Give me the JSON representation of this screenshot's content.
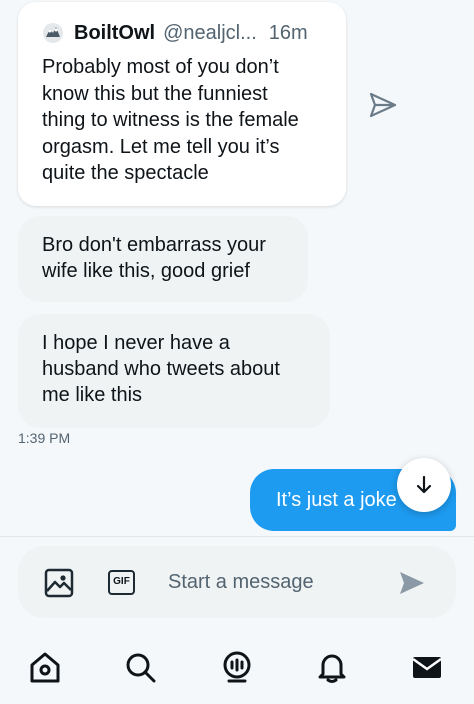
{
  "quoted_tweet": {
    "display_name": "BoiltOwl",
    "handle": "@nealjcl...",
    "time": "16m",
    "lines": [
      "Probably most of you don’t",
      "know this but the funniest",
      "thing to witness is the female",
      "orgasm. Let me tell you it’s",
      "quite the spectacle"
    ]
  },
  "messages": [
    {
      "direction": "received",
      "lines": [
        "Bro don't embarrass your",
        "wife like this, good grief"
      ]
    },
    {
      "direction": "received",
      "lines": [
        "I hope I never have a",
        "husband who tweets about",
        "me like this"
      ]
    },
    {
      "direction": "sent",
      "text": "It’s just a joke"
    }
  ],
  "timestamp": "1:39 PM",
  "composer": {
    "placeholder": "Start a message",
    "gif_label": "GIF"
  },
  "nav": [
    "home-icon",
    "search-icon",
    "spaces-icon",
    "notifications-icon",
    "messages-icon"
  ],
  "colors": {
    "accent": "#1d9bf0",
    "bubble_received": "#eff3f4",
    "background": "#f5f8fa",
    "text_secondary": "#536471"
  }
}
